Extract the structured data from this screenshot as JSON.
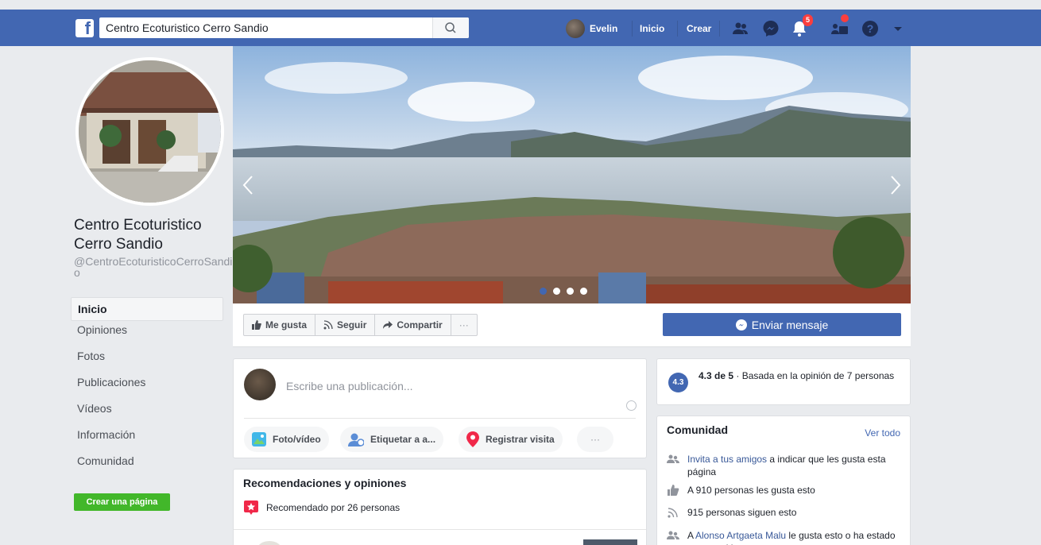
{
  "header": {
    "search_value": "Centro Ecoturistico Cerro Sandio",
    "user_name": "Evelin",
    "home_label": "Inicio",
    "create_label": "Crear",
    "notifications_count": "5"
  },
  "page": {
    "name": "Centro Ecoturistico Cerro Sandio",
    "handle": "@CentroEcoturisticoCerroSandio"
  },
  "left_nav": {
    "items": [
      "Inicio",
      "Opiniones",
      "Fotos",
      "Publicaciones",
      "Vídeos",
      "Información",
      "Comunidad"
    ],
    "create_page": "Crear una página"
  },
  "actions": {
    "like": "Me gusta",
    "follow": "Seguir",
    "share": "Compartir",
    "more": "···",
    "send_message": "Enviar mensaje"
  },
  "composer": {
    "placeholder": "Escribe una publicación...",
    "photo": "Foto/vídeo",
    "tag": "Etiquetar a a...",
    "checkin": "Registrar visita",
    "more": "···"
  },
  "recommendations": {
    "title": "Recomendaciones y opiniones",
    "recommended_by": "Recomendado por 26 personas"
  },
  "rating": {
    "badge": "4.3",
    "score": "4.3 de 5",
    "detail": " · Basada en la opinión de 7 personas"
  },
  "community": {
    "title": "Comunidad",
    "see_all": "Ver todo",
    "invite_link": "Invita a tus amigos",
    "invite_rest": " a indicar que les gusta esta página",
    "likes": "A 910 personas les gusta esto",
    "follows": "915 personas siguen esto",
    "friend_prefix": "A ",
    "friend_name": "Alonso Artgaeta Malu",
    "friend_rest": " le gusta esto o ha estado en este sitio"
  },
  "colors": {
    "brand_blue": "#4267b2",
    "green": "#42b72a",
    "badge_red": "#fa3e3e"
  }
}
